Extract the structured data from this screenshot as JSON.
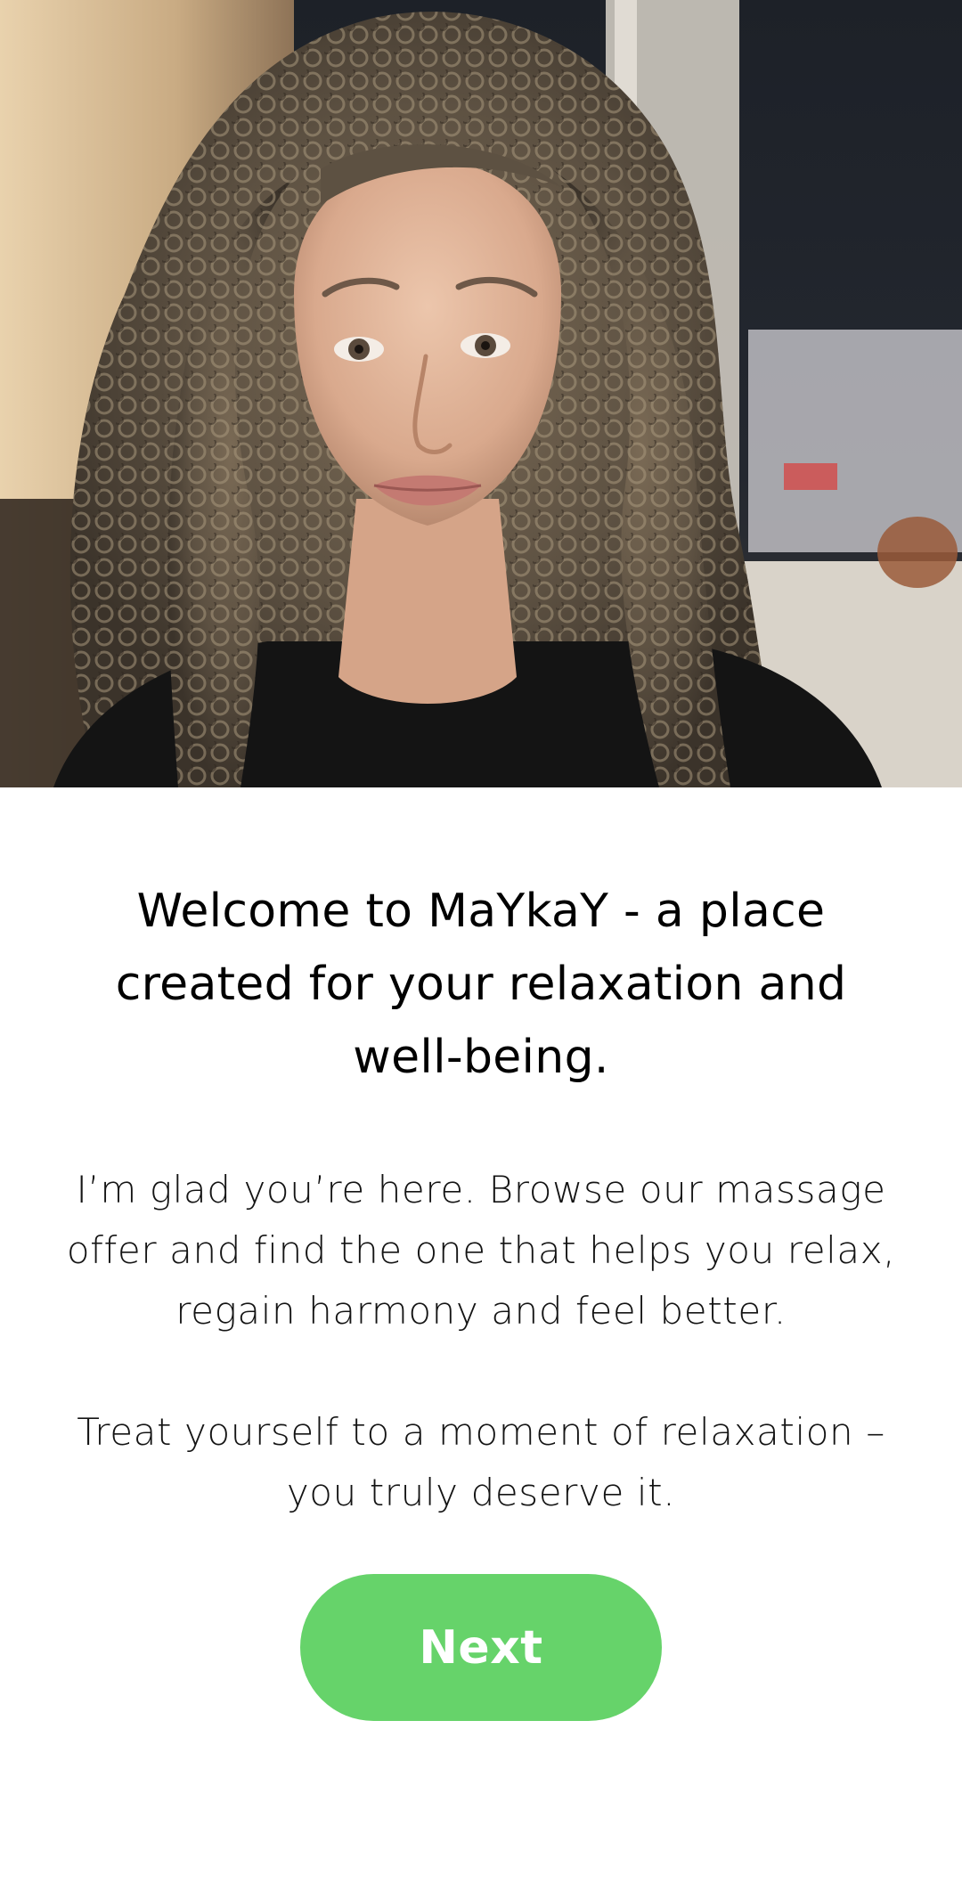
{
  "hero": {
    "image_icon": "portrait-photo",
    "image_alt": "Smiling woman with long curly hair"
  },
  "welcome": {
    "title": "Welcome to MaYkaY - a place created for your relaxation and well-being.",
    "paragraph_1": "I’m glad you’re here. Browse our massage offer and find the one that helps you relax, regain harmony and feel better.",
    "paragraph_2": "Treat yourself to a moment of relaxation – you truly deserve it."
  },
  "actions": {
    "next_label": "Next"
  },
  "colors": {
    "accent": "#66d36a",
    "background": "#ffffff",
    "text": "#000000"
  }
}
